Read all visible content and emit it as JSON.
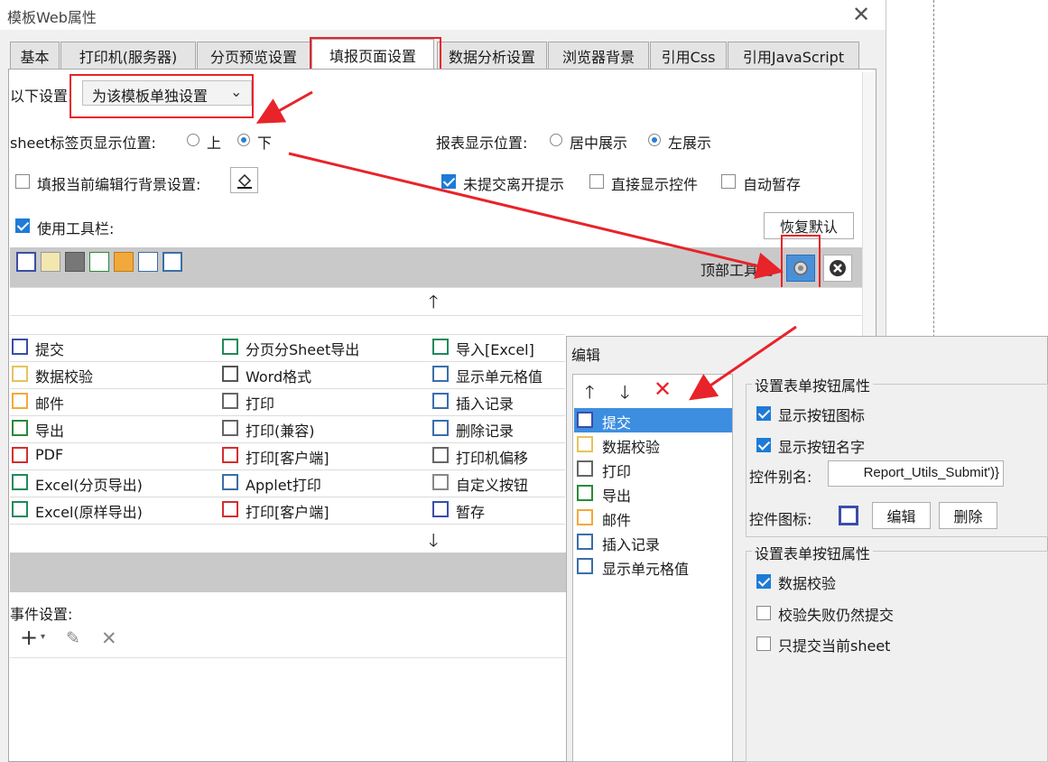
{
  "window": {
    "title": "模板Web属性",
    "close_icon": "close-icon"
  },
  "tabs": [
    {
      "label": "基本"
    },
    {
      "label": "打印机(服务器)"
    },
    {
      "label": "分页预览设置"
    },
    {
      "label": "填报页面设置",
      "active": true
    },
    {
      "label": "数据分析设置"
    },
    {
      "label": "浏览器背景"
    },
    {
      "label": "引用Css"
    },
    {
      "label": "引用JavaScript"
    }
  ],
  "settings": {
    "apply_label": "以下设置:",
    "apply_value": "为该模板单独设置",
    "sheet_position_label": "sheet标签页显示位置:",
    "sheet_top": "上",
    "sheet_bottom": "下",
    "report_position_label": "报表显示位置:",
    "report_center": "居中展示",
    "report_left": "左展示",
    "bg_setting_label": "填报当前编辑行背景设置:",
    "unsubmitted_warning": "未提交离开提示",
    "direct_show_widget": "直接显示控件",
    "auto_save": "自动暂存",
    "use_toolbar": "使用工具栏:",
    "restore_default": "恢复默认",
    "top_toolbar_label": "顶部工具栏"
  },
  "buttons": {
    "col1": [
      "提交",
      "数据校验",
      "邮件",
      "导出",
      "PDF",
      "Excel(分页导出)",
      "Excel(原样导出)"
    ],
    "col2": [
      "分页分Sheet导出",
      "Word格式",
      "打印",
      "打印(兼容)",
      "打印[客户端]",
      "Applet打印",
      "打印[客户端]"
    ],
    "col3": [
      "导入[Excel]",
      "显示单元格值",
      "插入记录",
      "删除记录",
      "打印机偏移",
      "自定义按钮",
      "暂存"
    ]
  },
  "events": {
    "label": "事件设置:"
  },
  "dialog": {
    "title": "编辑",
    "list": [
      "提交",
      "数据校验",
      "打印",
      "导出",
      "邮件",
      "插入记录",
      "显示单元格值"
    ],
    "group1_title": "设置表单按钮属性",
    "show_icon": "显示按钮图标",
    "show_name": "显示按钮名字",
    "alias_label": "控件别名:",
    "alias_value": "Report_Utils_Submit')}",
    "icon_label": "控件图标:",
    "edit_btn": "编辑",
    "delete_btn": "删除",
    "group2_title": "设置表单按钮属性",
    "data_validate": "数据校验",
    "submit_on_fail": "校验失败仍然提交",
    "submit_current_sheet": "只提交当前sheet"
  },
  "colors": {
    "accent_red": "#e8232a",
    "check_blue": "#1e7bd6",
    "toolbar_gray": "#c9c9c9",
    "selection": "#3d8ee0"
  }
}
